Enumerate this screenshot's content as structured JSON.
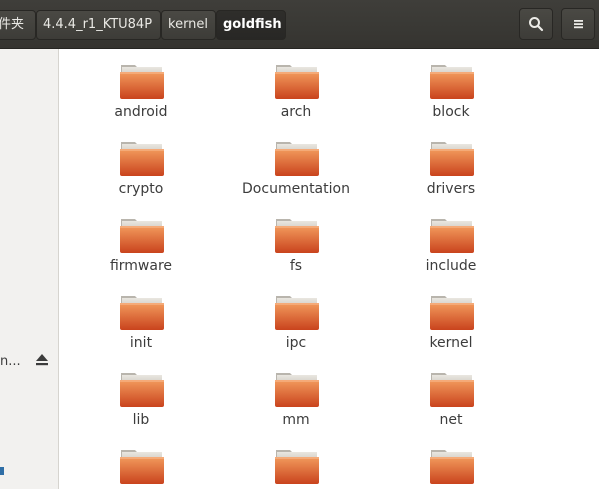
{
  "breadcrumb": {
    "items": [
      {
        "label": "件夹"
      },
      {
        "label": "4.4.4_r1_KTU84P"
      },
      {
        "label": "kernel"
      },
      {
        "label": "goldfish"
      }
    ]
  },
  "toolbar": {
    "search_icon": "search-icon",
    "menu_icon": "hamburger-menu-icon"
  },
  "sidebar": {
    "device_label": "n...",
    "eject_icon": "eject-icon"
  },
  "files": [
    {
      "name": "android"
    },
    {
      "name": "arch"
    },
    {
      "name": "block"
    },
    {
      "name": "crypto"
    },
    {
      "name": "Documentation"
    },
    {
      "name": "drivers"
    },
    {
      "name": "firmware"
    },
    {
      "name": "fs"
    },
    {
      "name": "include"
    },
    {
      "name": "init"
    },
    {
      "name": "ipc"
    },
    {
      "name": "kernel"
    },
    {
      "name": "lib"
    },
    {
      "name": "mm"
    },
    {
      "name": "net"
    },
    {
      "name": ""
    },
    {
      "name": ""
    },
    {
      "name": ""
    }
  ],
  "colors": {
    "folder_top": "#f08a4b",
    "folder_bottom": "#c8401a",
    "header_bg": "#3a3935"
  }
}
